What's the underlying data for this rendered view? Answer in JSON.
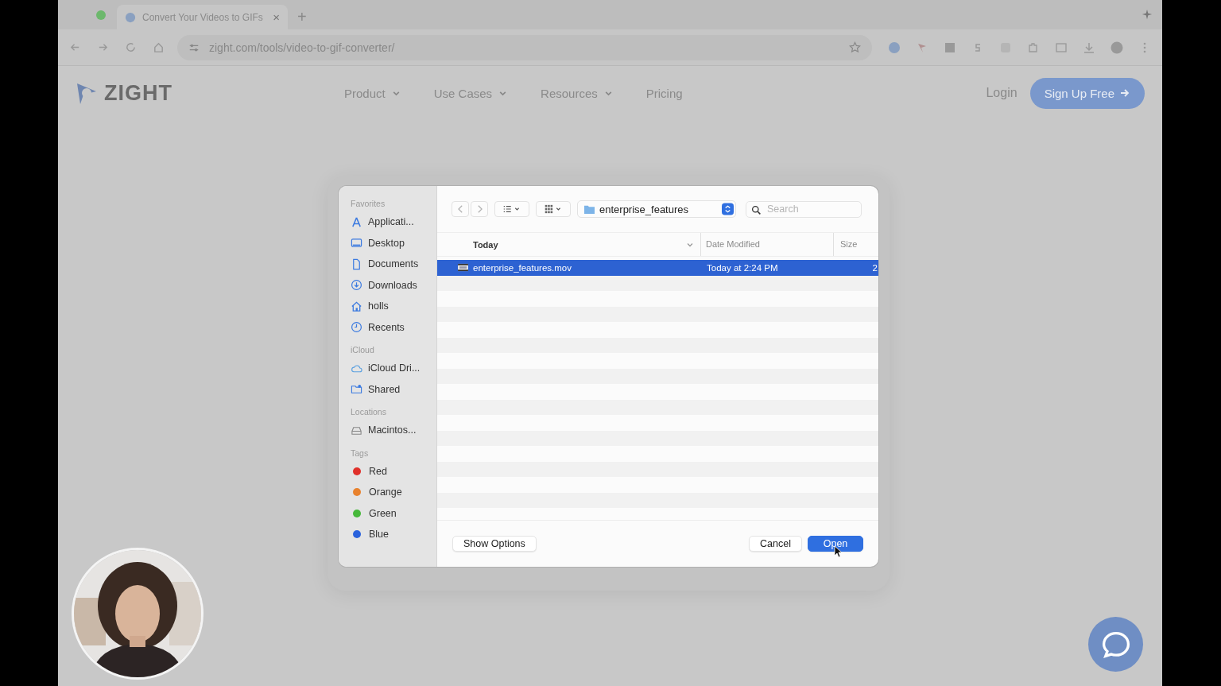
{
  "browser": {
    "tab": {
      "title": "Convert Your Videos to GIFs",
      "close": "×"
    },
    "new_tab": "+",
    "address": "zight.com/tools/video-to-gif-converter/"
  },
  "site": {
    "logo": "ZIGHT",
    "nav": [
      {
        "label": "Product",
        "has_menu": true
      },
      {
        "label": "Use Cases",
        "has_menu": true
      },
      {
        "label": "Resources",
        "has_menu": true
      },
      {
        "label": "Pricing",
        "has_menu": false
      }
    ],
    "login": "Login",
    "signup": "Sign Up Free"
  },
  "dialog": {
    "sidebar": [
      {
        "title": "Favorites",
        "items": [
          {
            "label": "Applicati...",
            "kind": "apps"
          },
          {
            "label": "Desktop",
            "kind": "desktop"
          },
          {
            "label": "Documents",
            "kind": "document"
          },
          {
            "label": "Downloads",
            "kind": "download"
          },
          {
            "label": "holls",
            "kind": "home"
          },
          {
            "label": "Recents",
            "kind": "clock"
          }
        ]
      },
      {
        "title": "iCloud",
        "items": [
          {
            "label": "iCloud Dri...",
            "kind": "cloud"
          },
          {
            "label": "Shared",
            "kind": "shared"
          }
        ]
      },
      {
        "title": "Locations",
        "items": [
          {
            "label": "Macintos...",
            "kind": "disk"
          }
        ]
      },
      {
        "title": "Tags",
        "items": [
          {
            "label": "Red",
            "kind": "tag",
            "color": "#e0302a"
          },
          {
            "label": "Orange",
            "kind": "tag",
            "color": "#e8822e"
          },
          {
            "label": "Green",
            "kind": "tag",
            "color": "#46b83a"
          },
          {
            "label": "Blue",
            "kind": "tag",
            "color": "#2a62dc"
          }
        ]
      }
    ],
    "folder": "enterprise_features",
    "search": {
      "placeholder": "Search"
    },
    "columns": [
      "Today",
      "Date Modified",
      "Size"
    ],
    "files": [
      {
        "name": "enterprise_features.mov",
        "date": "Today at 2:24 PM",
        "size": "2",
        "selected": true
      }
    ],
    "buttons": {
      "options": "Show Options",
      "cancel": "Cancel",
      "open": "Open"
    }
  }
}
